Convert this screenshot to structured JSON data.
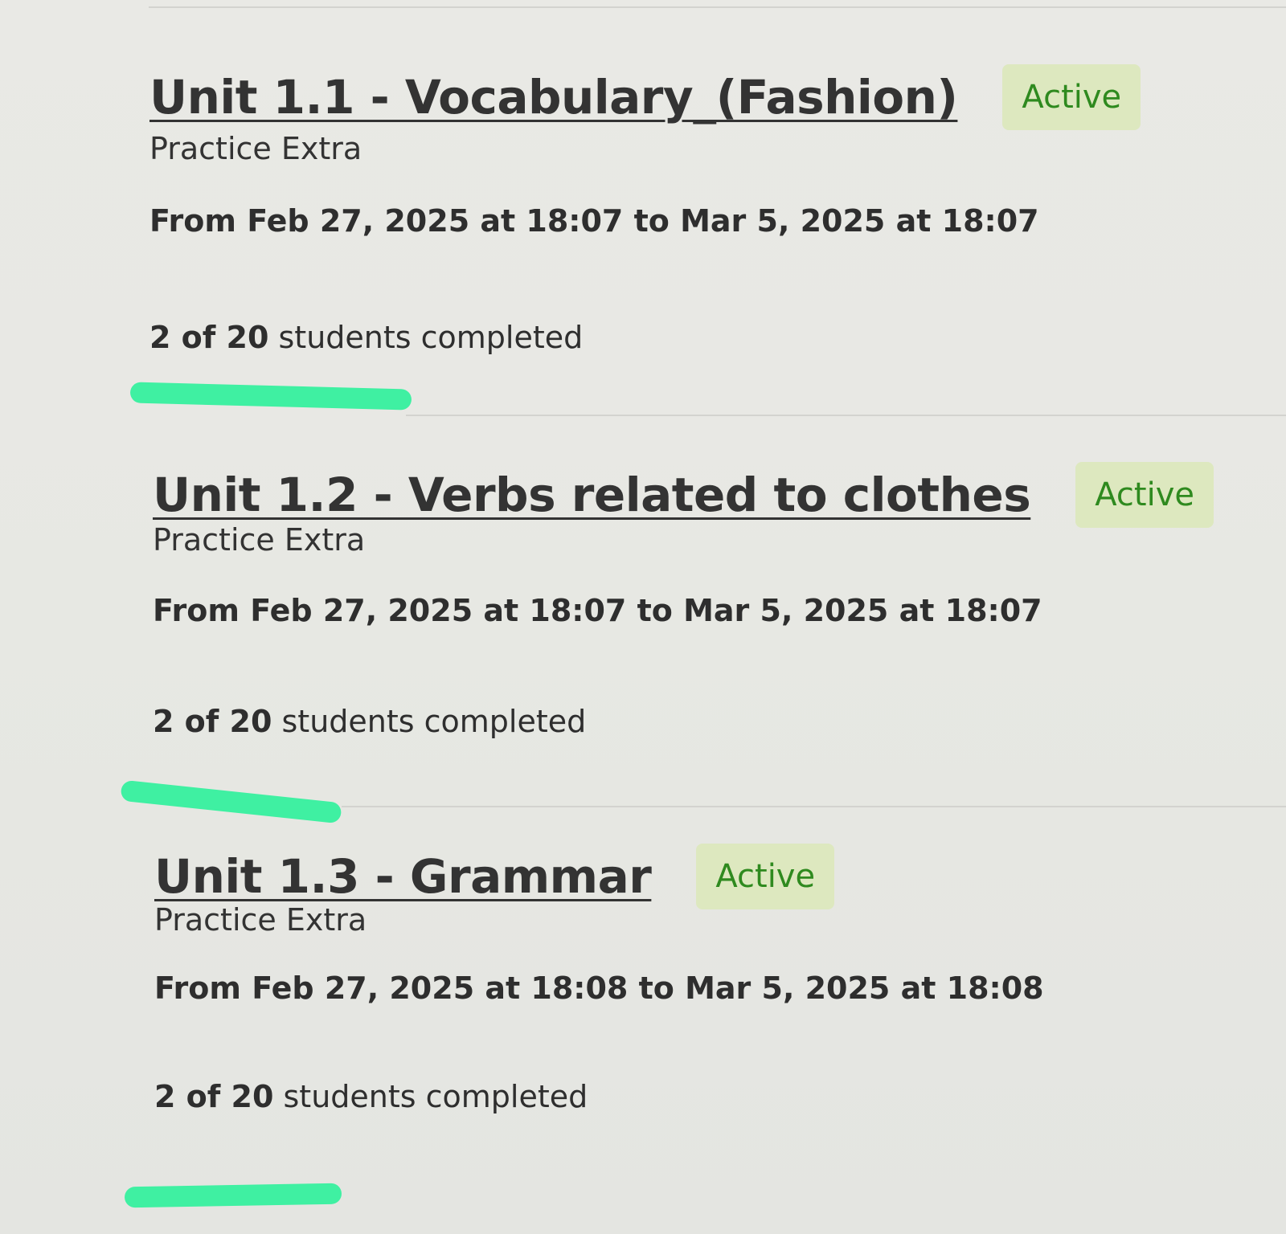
{
  "assignments": [
    {
      "title": "Unit 1.1 - Vocabulary_(Fashion)",
      "status": "Active",
      "type": "Practice Extra",
      "dates": "From Feb 27, 2025 at 18:07 to Mar 5, 2025 at 18:07",
      "completed_prefix": "2 of 20",
      "completed_suffix": " students completed"
    },
    {
      "title": "Unit 1.2 - Verbs related to clothes",
      "status": "Active",
      "type": "Practice Extra",
      "dates": "From Feb 27, 2025 at 18:07 to Mar 5, 2025 at 18:07",
      "completed_prefix": "2 of 20",
      "completed_suffix": " students completed"
    },
    {
      "title": "Unit 1.3 - Grammar",
      "status": "Active",
      "type": "Practice Extra",
      "dates": "From Feb 27, 2025 at 18:08 to Mar 5, 2025 at 18:08",
      "completed_prefix": "2 of 20",
      "completed_suffix": " students completed"
    }
  ],
  "colors": {
    "badge_bg": "#dde8bf",
    "badge_text": "#2f8a1f",
    "highlight_marker": "#3ff0a2"
  }
}
